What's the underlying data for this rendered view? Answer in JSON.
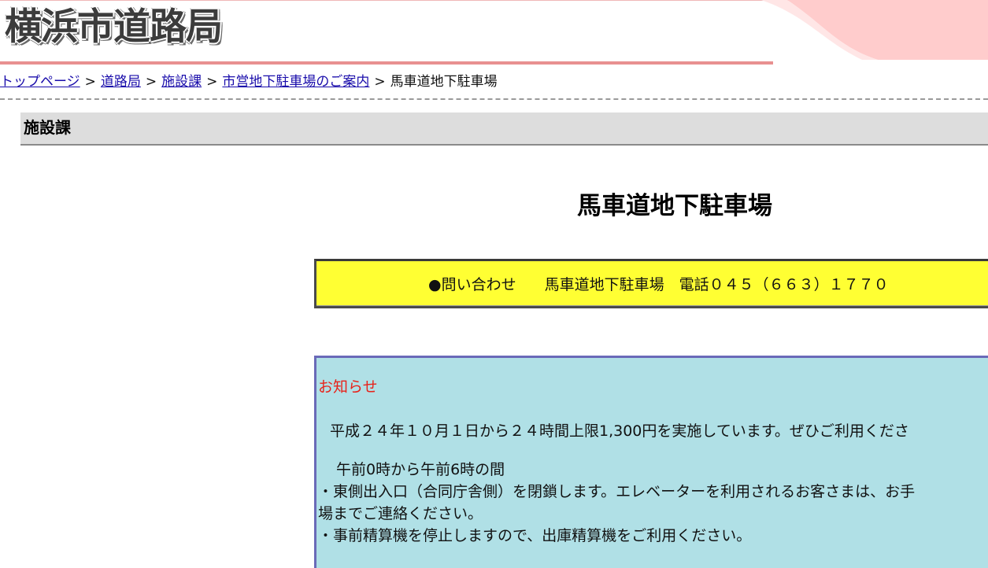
{
  "header": {
    "logo_text": "横浜市道路局",
    "colors": {
      "rule": "#e89090",
      "wave": "#ffcccc",
      "logo": "#3c3c3c"
    }
  },
  "breadcrumb": {
    "items": [
      {
        "label": "トップページ",
        "link": true
      },
      {
        "label": "道路局",
        "link": true
      },
      {
        "label": "施設課",
        "link": true
      },
      {
        "label": "市営地下駐車場のご案内",
        "link": true
      },
      {
        "label": "馬車道地下駐車場",
        "link": false
      }
    ],
    "separator": ">"
  },
  "section": {
    "title": "施設課"
  },
  "page": {
    "title": "馬車道地下駐車場"
  },
  "contact": {
    "label": "●問い合わせ",
    "name": "馬車道地下駐車場",
    "phone": "電話０４５（６６３）１７７０",
    "bg_color": "#ffff33"
  },
  "notice": {
    "heading": "お知らせ",
    "line1": "平成２４年１０月１日から２４時間上限1,300円を実施しています。ぜひご利用くださ",
    "line2": "午前0時から午前6時の間",
    "line3": "・東側出入口（合同庁舎側）を閉鎖します。エレベーターを利用されるお客さまは、お手",
    "line4": "場までご連絡ください。",
    "line5": "・事前精算機を停止しますので、出庫精算機をご利用ください。",
    "bg_color": "#b0e0e6",
    "heading_color": "#e8221a"
  }
}
